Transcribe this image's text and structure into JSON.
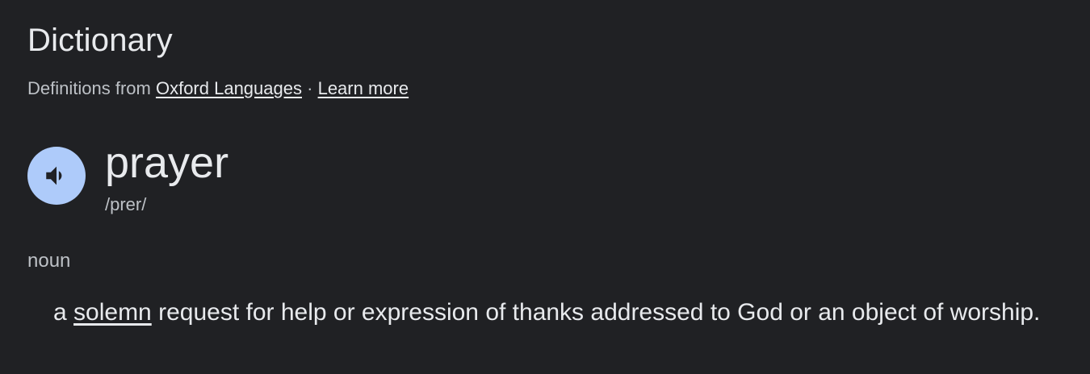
{
  "header": {
    "title": "Dictionary",
    "source_prefix": "Definitions from",
    "source_link": "Oxford Languages",
    "separator": "·",
    "learn_more": "Learn more"
  },
  "entry": {
    "headword": "prayer",
    "phonetic": "/prer/",
    "part_of_speech": "noun",
    "definition": {
      "before_link": "a",
      "link_text": "solemn",
      "after_link": "request for help or expression of thanks addressed to God or an object of worship."
    }
  },
  "icons": {
    "pronounce": "speaker-icon"
  },
  "colors": {
    "background": "#202124",
    "primary_text": "#e8eaed",
    "secondary_text": "#bdc1c6",
    "speaker_button": "#aecbfa",
    "speaker_glyph": "#202124"
  }
}
